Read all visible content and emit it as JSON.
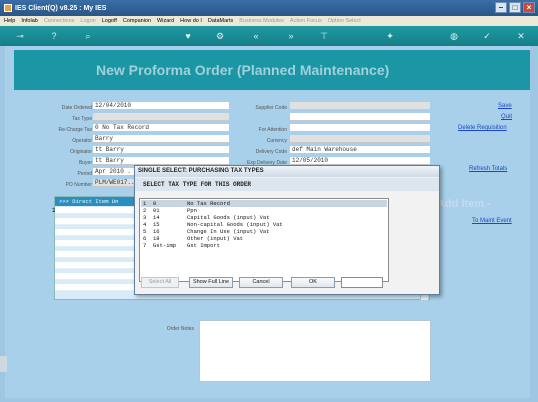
{
  "window": {
    "title": "IES Client(Q) v8.25 : My IES"
  },
  "menu": [
    "Help",
    "Infolab",
    "Connections",
    "Logon",
    "Logoff",
    "Companion",
    "Wizard",
    "How do I",
    "DataMarts",
    "Business Modules",
    "Action Focus",
    "Option Select"
  ],
  "menu_disabled": [
    false,
    false,
    true,
    true,
    false,
    false,
    false,
    false,
    false,
    true,
    true,
    true
  ],
  "page": {
    "title": "New Proforma Order (Planned Maintenance)"
  },
  "form": {
    "date_ordered_label": "Date Ordered",
    "date_ordered": "12/04/2010",
    "tax_type_label": "Tax Type",
    "tax_type": "",
    "recharge_tax_label": "Re-Charge Tax",
    "recharge_tax": "0 No Tax Record",
    "operator_label": "Operator",
    "operator": "Barry",
    "originator_label": "Originator",
    "originator": "tt Barry",
    "buyer_label": "Buyer",
    "buyer": "tt Barry",
    "period_label": "Period",
    "period": "Apr 2010 .",
    "po_number_label": "PO Number",
    "po_number": "PLM/WE017...",
    "supplier_code_label": "Supplier Code",
    "supplier_code": "",
    "for_attention_label": "For Attention",
    "for_attention": "",
    "currency_label": "Currency",
    "currency": "",
    "delivery_code_label": "Delivery Code",
    "delivery_code": "def Main Warehouse",
    "exp_delivery_label": "Exp Delivery Date",
    "exp_delivery": "12/05/2010"
  },
  "actions": {
    "save": "Save",
    "quit": "Quit",
    "delete": "Delete Requisition",
    "refresh": "Refresh Totals",
    "add_item": "Add Item -",
    "maint_event": "To Maint Event"
  },
  "grid": {
    "header": ">>> Direct Item  Un",
    "row_marker": "1"
  },
  "order_notes_label": "Order Notes",
  "dialog": {
    "title": "SINGLE SELECT: PURCHASING TAX TYPES",
    "heading": "SELECT TAX TYPE FOR THIS ORDER",
    "options": [
      {
        "idx": "1",
        "code": "0",
        "name": "No Tax Record"
      },
      {
        "idx": "2",
        "code": "01",
        "name": "Ppn"
      },
      {
        "idx": "3",
        "code": "14",
        "name": "Capital Goods (input) Vat"
      },
      {
        "idx": "4",
        "code": "15",
        "name": "Non-capital Goods (input) Vat"
      },
      {
        "idx": "5",
        "code": "16",
        "name": "Change In Use (input) Vat"
      },
      {
        "idx": "6",
        "code": "18",
        "name": "Other (input) Vat"
      },
      {
        "idx": "7",
        "code": "Gst-imp",
        "name": "Gst Import"
      }
    ],
    "selected_index": 0,
    "buttons": {
      "select_all": "Select All",
      "show_full_line": "Show Full Line",
      "cancel": "Cancel",
      "ok": "OK"
    },
    "input_value": ""
  }
}
